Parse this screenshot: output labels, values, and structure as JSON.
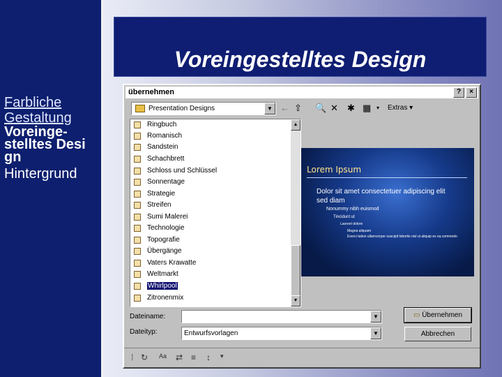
{
  "slide": {
    "title": "Voreingestelltes Design",
    "nav": [
      "Farbliche",
      "Gestaltung",
      "Voreinge-",
      "stelltes Desi",
      "gn",
      "Hintergrund"
    ]
  },
  "dialog": {
    "title": "übernehmen",
    "help": "?",
    "close": "×",
    "lookin": "Presentation Designs",
    "extras": "Extras",
    "files": [
      "Ringbuch",
      "Romanisch",
      "Sandstein",
      "Schachbrett",
      "Schloss und Schlüssel",
      "Sonnentage",
      "Strategie",
      "Streifen",
      "Sumi Malerei",
      "Technologie",
      "Topografie",
      "Übergänge",
      "Vaters Krawatte",
      "Weltmarkt",
      "Whirlpool",
      "Zitronenmix"
    ],
    "selected_index": 14,
    "preview": {
      "title": "Lorem Ipsum",
      "bullet1": "Dolor sit amet consectetuer adipiscing elit sed diam",
      "bullet2": "Nonummy nibh euismod",
      "bullet3": "Tincidunt ut",
      "bullet4": "Laoreet dolore",
      "bullet5": "Magna aliquam",
      "bullet6": "Exerci tation ullamcorper suscipit lobortis nisl ut aliquip ex ea commodo"
    },
    "filename_label": "Dateiname:",
    "filename_value": "",
    "filetype_label": "Dateityp:",
    "filetype_value": "Entwurfsvorlagen",
    "apply_button": "Übernehmen",
    "cancel_button": "Abbrechen"
  },
  "colors": {
    "sidebar": "#0d1f6e",
    "title_box": "#0f1e72",
    "selection": "#101070"
  }
}
